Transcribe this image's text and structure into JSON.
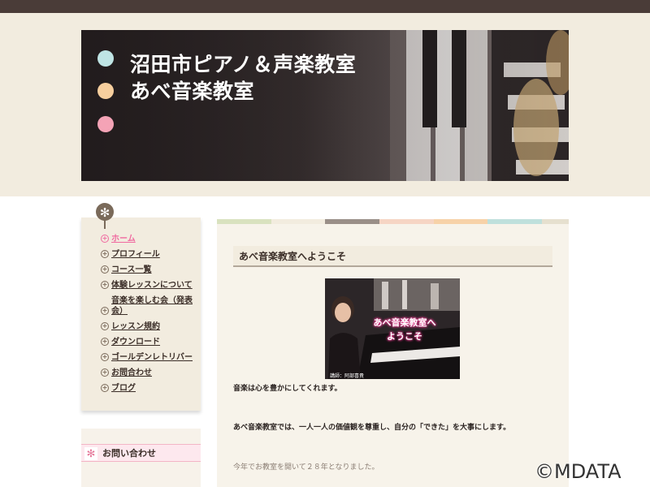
{
  "header": {
    "title_line1": "沼田市ピアノ＆声楽教室",
    "title_line2": "あべ音楽教室"
  },
  "colors": {
    "topbar": "#4a3c38",
    "header_bg": "#f2ecdf",
    "dot_blue": "#bfe4e4",
    "dot_orange": "#f7cf9e",
    "dot_pink": "#f4a3b6",
    "nav_active": "#f06aa0"
  },
  "nav": {
    "pin_icon": "✻",
    "items": [
      {
        "label": "ホーム",
        "active": true
      },
      {
        "label": "プロフィール"
      },
      {
        "label": "コース一覧"
      },
      {
        "label": "体験レッスンについて"
      },
      {
        "label": "音楽を楽しむ会（発表会）"
      },
      {
        "label": "レッスン規約"
      },
      {
        "label": "ダウンロード"
      },
      {
        "label": "ゴールデンレトリバー"
      },
      {
        "label": "お問合わせ"
      },
      {
        "label": "ブログ"
      }
    ]
  },
  "contact": {
    "icon": "✻",
    "title": "お問い合わせ"
  },
  "main": {
    "post_title": "あべ音楽教室へようこそ",
    "image_overlay_line1": "あべ音楽教室へ",
    "image_overlay_line2": "ようこそ",
    "image_caption": "講師：阿部喜貴",
    "para1": "音楽は心を豊かにしてくれます。",
    "para2": "あべ音楽教室では、一人一人の価値観を尊重し、自分の「できた」を大事にします。",
    "para3": "今年でお教室を開いて２８年となりました。"
  },
  "watermark": "©MDATA"
}
